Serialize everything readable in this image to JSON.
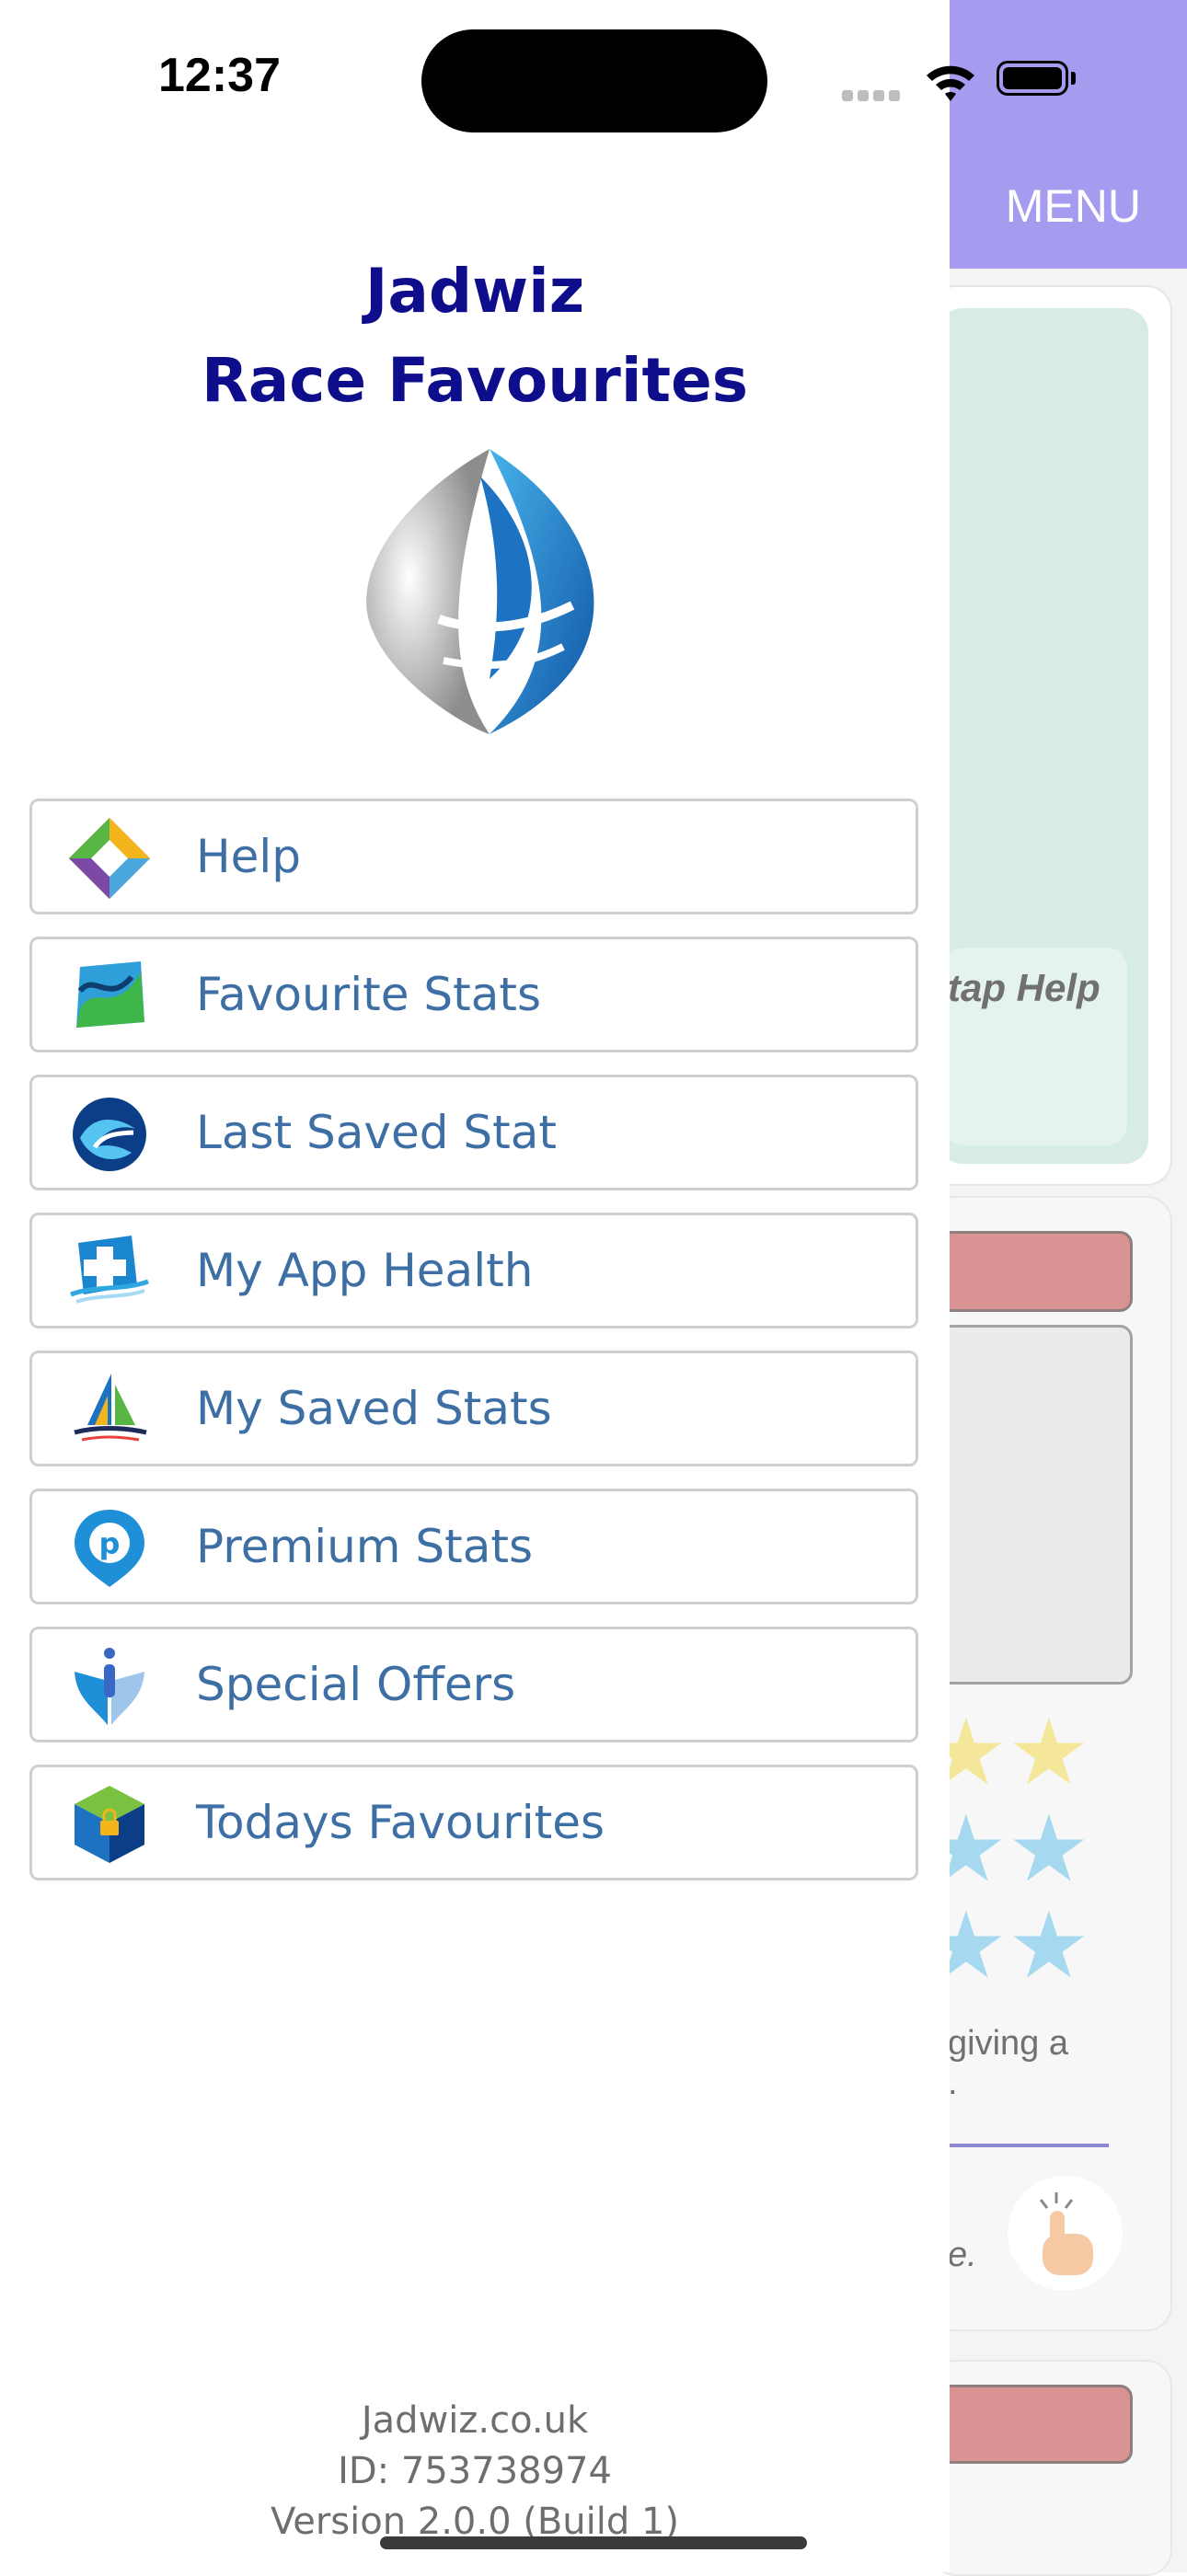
{
  "status_bar": {
    "time": "12:37"
  },
  "background_app": {
    "menu_label": "MENU",
    "card_hint": "tap Help",
    "partial_text_1": "giving a",
    "partial_text_2": ".",
    "partial_text_3": "e.",
    "header_color": "#a59bef"
  },
  "drawer": {
    "title_line1": "Jadwiz",
    "title_line2": "Race Favourites",
    "title_color": "#0e0d8c",
    "menu": [
      {
        "label": "Help",
        "icon": "colorful-diamond-icon"
      },
      {
        "label": "Favourite Stats",
        "icon": "green-blue-square-icon"
      },
      {
        "label": "Last Saved Stat",
        "icon": "blue-swirl-orb-icon"
      },
      {
        "label": "My App Health",
        "icon": "medical-cross-icon"
      },
      {
        "label": "My Saved Stats",
        "icon": "sailboat-icon"
      },
      {
        "label": "Premium Stats",
        "icon": "p-pin-icon"
      },
      {
        "label": "Special Offers",
        "icon": "person-hands-icon"
      },
      {
        "label": "Todays Favourites",
        "icon": "locked-cube-icon"
      }
    ],
    "menu_label_color": "#3d6fa4",
    "footer": {
      "site": "Jadwiz.co.uk",
      "id": "ID: 753738974",
      "version": "Version 2.0.0 (Build 1)"
    }
  }
}
